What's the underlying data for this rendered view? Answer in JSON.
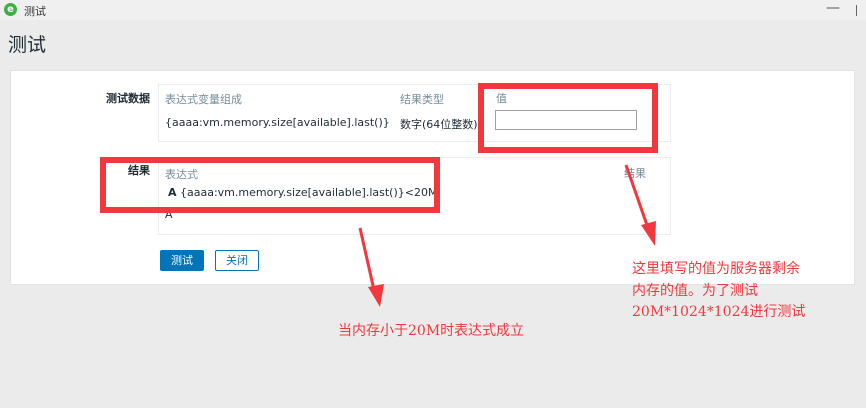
{
  "window": {
    "title": "测试",
    "minimize_label": "—"
  },
  "page": {
    "title": "测试"
  },
  "test_data": {
    "label": "测试数据",
    "headers": {
      "expression_var": "表达式变量组成",
      "result_type": "结果类型",
      "value": "值"
    },
    "row": {
      "expression_var": "{aaaa:vm.memory.size[available].last()}",
      "result_type": "数字(64位整数)",
      "value": ""
    }
  },
  "result": {
    "label": "结果",
    "headers": {
      "expression": "表达式",
      "result": "结果"
    },
    "row1": {
      "letter": "A",
      "expression": "{aaaa:vm.memory.size[available].last()}<20M"
    },
    "row2": {
      "letter": "A"
    }
  },
  "buttons": {
    "test": "测试",
    "close": "关闭"
  },
  "annotations": {
    "bottom": "当内存小于20M时表达式成立",
    "right_line1": "这里填写的值为服务器剩余",
    "right_line2": "内存的值。为了测试",
    "right_line3": "20M*1024*1024进行测试"
  },
  "colors": {
    "primary": "#0275b8",
    "annotation_red": "#f2383f",
    "app_icon": "#3fae49"
  }
}
